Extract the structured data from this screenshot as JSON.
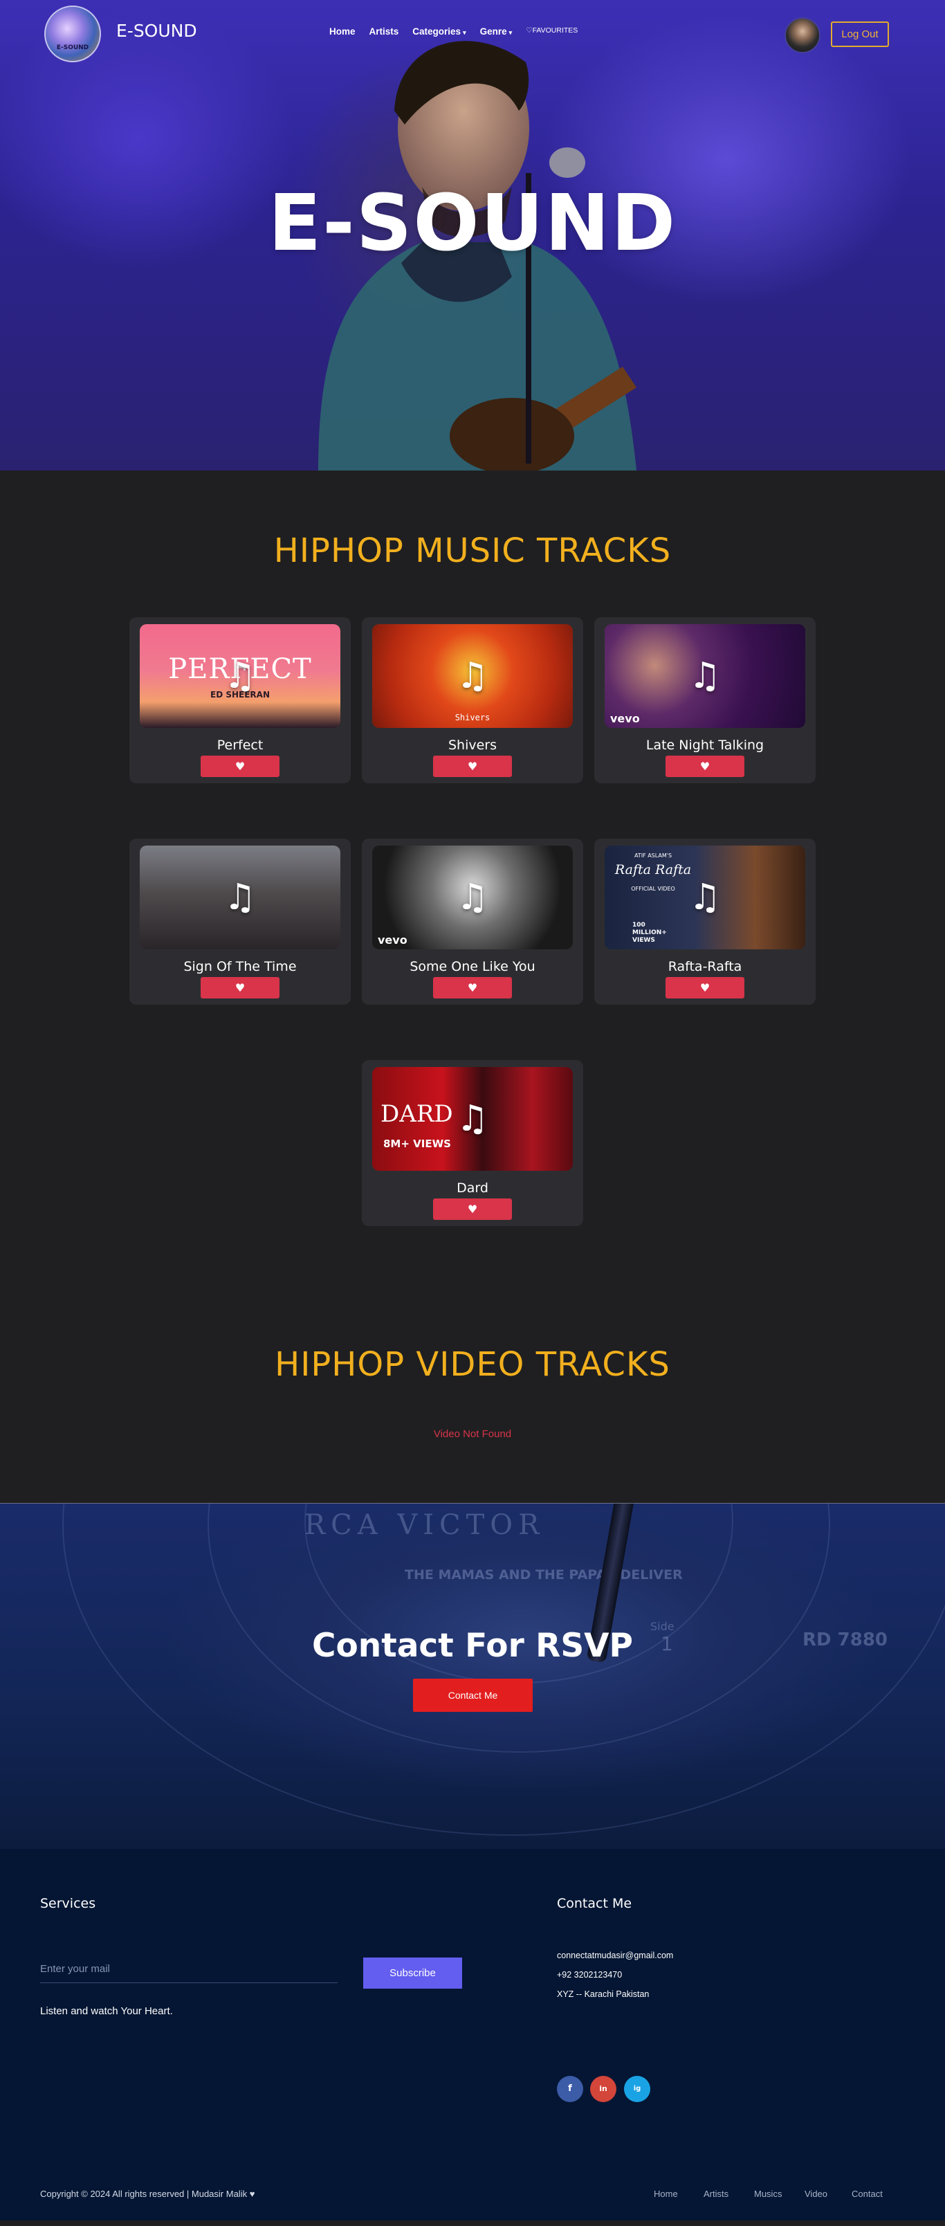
{
  "nav": {
    "logo_text": "E-SOUND",
    "brand": "E-SOUND",
    "links": [
      "Home",
      "Artists",
      "Categories",
      "Genre",
      "FAVOURITES"
    ],
    "logout": "Log Out"
  },
  "hero": {
    "title": "E-SOUND"
  },
  "music_section": {
    "title": "HIPHOP MUSIC TRACKS",
    "tracks": [
      {
        "title": "Perfect",
        "thumb_text": "PERFECT",
        "thumb_sub": "ED SHEERAN"
      },
      {
        "title": "Shivers",
        "thumb_text": "Shivers"
      },
      {
        "title": "Late Night Talking",
        "thumb_text": "vevo"
      },
      {
        "title": "Sign Of The Time"
      },
      {
        "title": "Some One Like You",
        "thumb_text": "vevo"
      },
      {
        "title": "Rafta-Rafta",
        "thumb_text": "Rafta Rafta",
        "thumb_top": "ATIF ASLAM'S",
        "thumb_sub": "OFFICIAL VIDEO",
        "thumb_badge": "100 MILLION+ VIEWS"
      },
      {
        "title": "Dard",
        "thumb_text": "DARD",
        "thumb_sub": "8M+ VIEWS"
      }
    ],
    "icons": {
      "note": "music-note-icon",
      "heart": "heart-icon"
    }
  },
  "video_section": {
    "title": "HIPHOP VIDEO TRACKS",
    "empty_message": "Video Not Found"
  },
  "contact": {
    "title": "Contact For RSVP",
    "button": "Contact Me",
    "record_label": "RCA VICTOR",
    "record_line": "THE MAMAS AND THE PAPAS DELIVER",
    "record_side": "Side",
    "record_side_num": "1",
    "record_code": "RD 7880"
  },
  "footer": {
    "services_title": "Services",
    "email_placeholder": "Enter your mail",
    "subscribe": "Subscribe",
    "tagline": "Listen and watch Your Heart.",
    "contact_title": "Contact Me",
    "email": "connectatmudasir@gmail.com",
    "phone": "+92 3202123470",
    "address": "XYZ -- Karachi Pakistan",
    "social": [
      "f",
      "in",
      "ig"
    ],
    "copyright": "Copyright © 2024 All rights reserved | Mudasir Malik",
    "links": [
      "Home",
      "Artists",
      "Musics",
      "Video",
      "Contact"
    ]
  },
  "colors": {
    "accent": "#f2b01e",
    "heart": "#d9344a",
    "subscribe": "#635ef0",
    "contact_button": "#e31e1e"
  }
}
